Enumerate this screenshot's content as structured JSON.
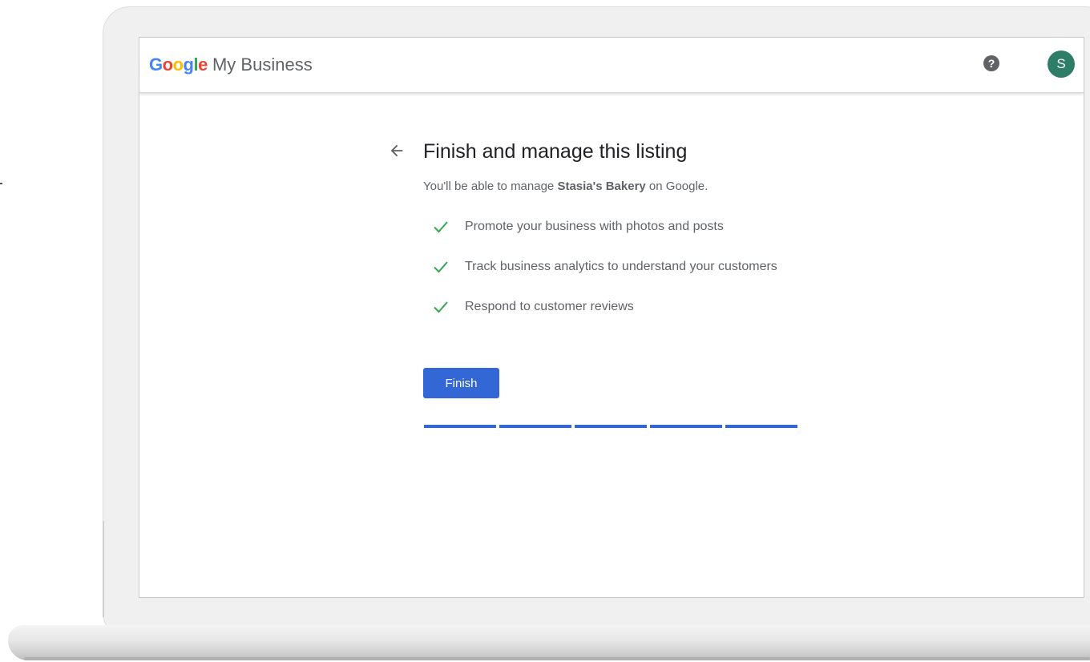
{
  "header": {
    "logo": {
      "letters": [
        {
          "char": "G",
          "color": "#4285F4"
        },
        {
          "char": "o",
          "color": "#EA4335"
        },
        {
          "char": "o",
          "color": "#FBBC05"
        },
        {
          "char": "g",
          "color": "#4285F4"
        },
        {
          "char": "l",
          "color": "#34A853"
        },
        {
          "char": "e",
          "color": "#EA4335"
        }
      ],
      "suffix": "My Business"
    },
    "help_icon": {
      "glyph": "?",
      "icon": "help-icon"
    },
    "avatar_initial": "S",
    "avatar_color": "#2e7d67"
  },
  "main": {
    "back_icon": "arrow-left-icon",
    "title": "Finish and manage this listing",
    "subtitle_before": "You'll be able to manage ",
    "business_name": "Stasia's Bakery",
    "subtitle_after": " on Google.",
    "features": [
      "Promote your business with photos and posts",
      "Track business analytics to understand your customers",
      "Respond to customer reviews"
    ],
    "check_icon": "check-icon",
    "check_color": "#34a853",
    "finish_label": "Finish",
    "progress": {
      "completed_steps": 5,
      "total_steps": 5,
      "color": "#3367d6"
    }
  }
}
